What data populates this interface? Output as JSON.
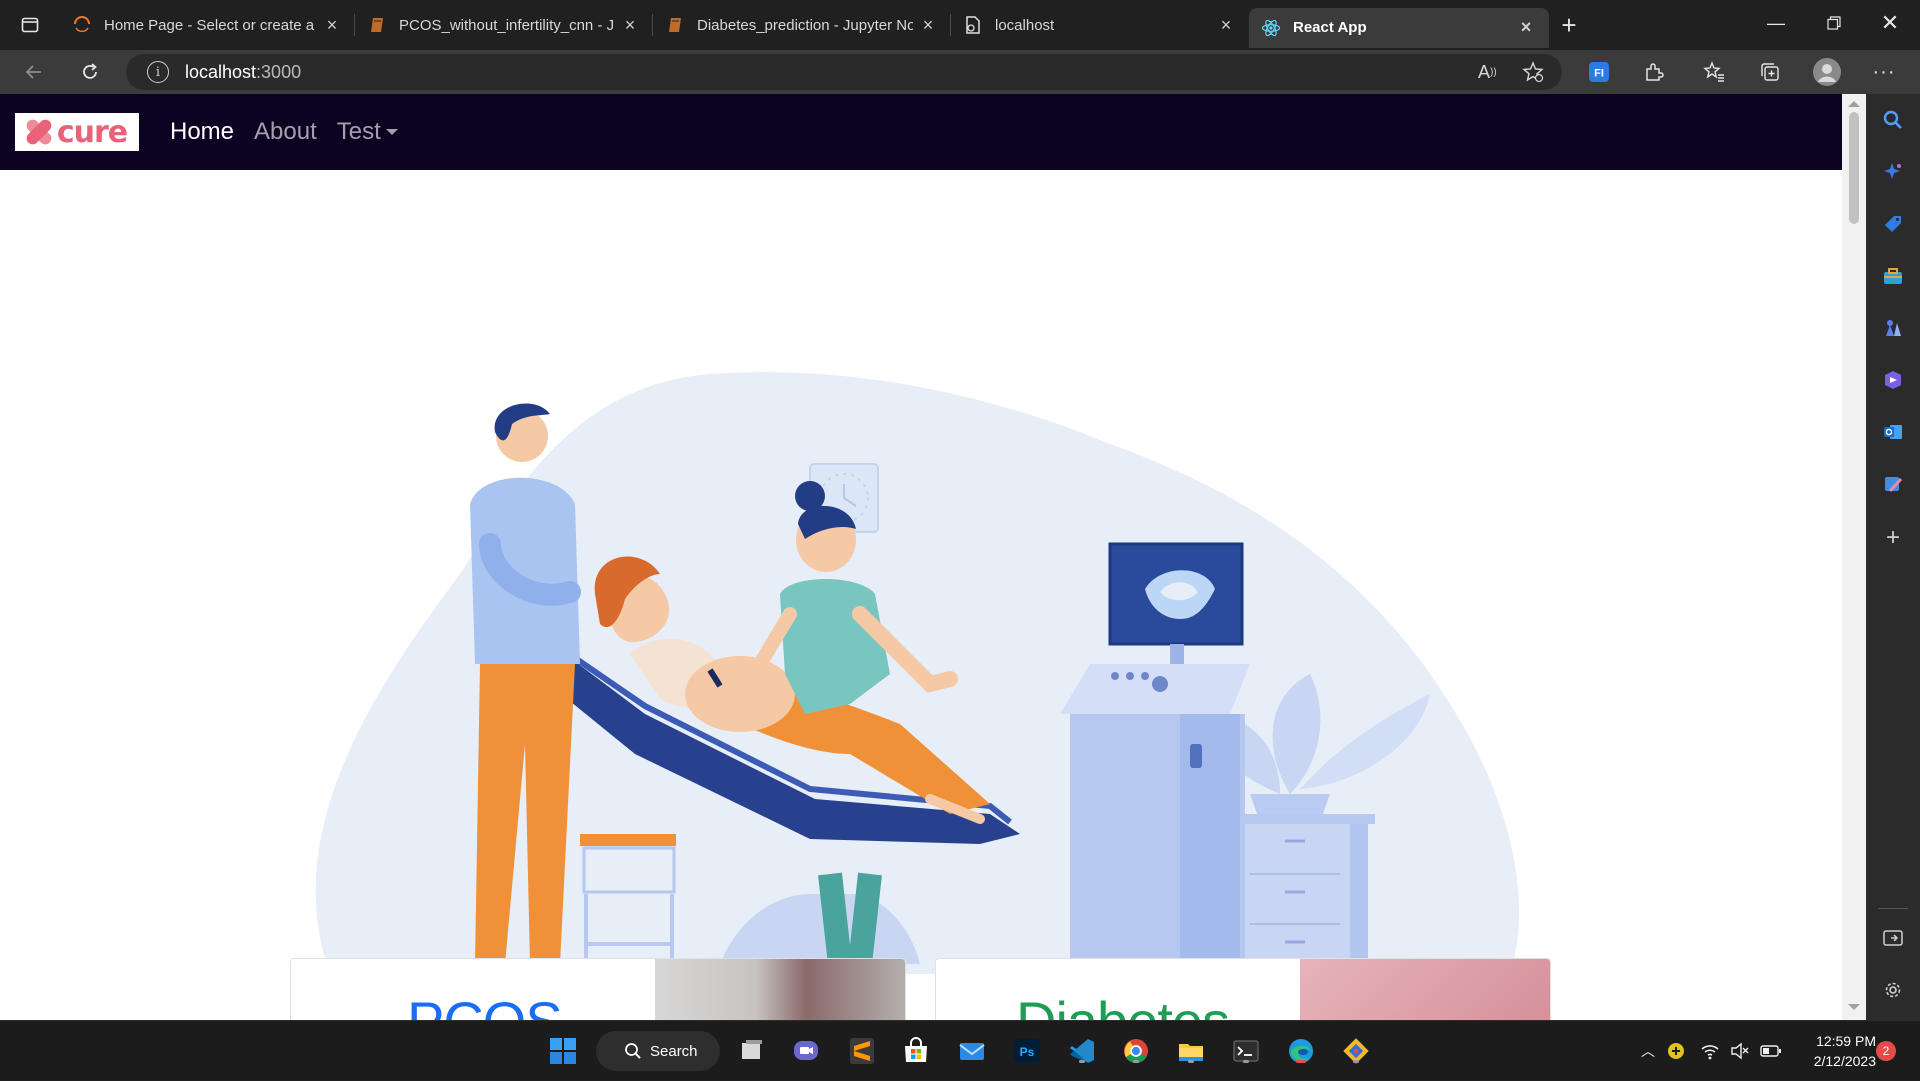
{
  "browser": {
    "tabs": [
      {
        "title": "Home Page - Select or create a n",
        "icon": "jupyter-icon"
      },
      {
        "title": "PCOS_without_infertility_cnn - Ju",
        "icon": "notebook-icon"
      },
      {
        "title": "Diabetes_prediction - Jupyter No",
        "icon": "notebook-icon"
      },
      {
        "title": "localhost",
        "icon": "page-icon"
      },
      {
        "title": "React App",
        "icon": "react-icon"
      }
    ],
    "address": {
      "host": "localhost",
      "port": ":3000"
    }
  },
  "app": {
    "brand": "cure",
    "nav": {
      "home": "Home",
      "about": "About",
      "test": "Test"
    },
    "carousel_next": "›",
    "cards": [
      {
        "title": "PCOS",
        "color": "#1b6ef3"
      },
      {
        "title": "Diabetes",
        "color": "#1f9d55"
      }
    ]
  },
  "taskbar": {
    "search_label": "Search",
    "time": "12:59 PM",
    "date": "2/12/2023",
    "notifications": "2"
  },
  "colors": {
    "navbar_bg": "#0c0322",
    "brand_pink": "#e8627a",
    "blob": "#e7eef8",
    "chair_blue": "#27418f",
    "orange": "#f0913a"
  }
}
